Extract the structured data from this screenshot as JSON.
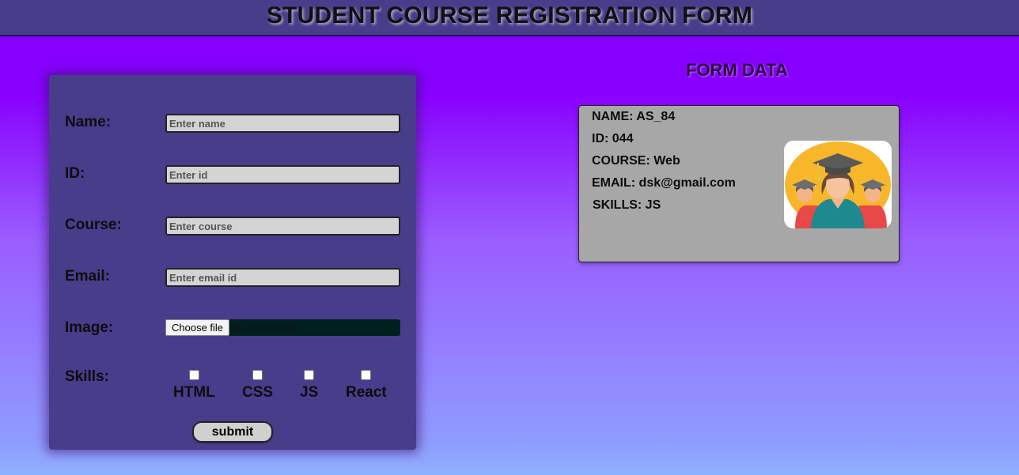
{
  "header": {
    "title": "STUDENT COURSE REGISTRATION FORM"
  },
  "form": {
    "name_label": "Name:",
    "name_placeholder": "Enter name",
    "id_label": "ID:",
    "id_placeholder": "Enter id",
    "course_label": "Course:",
    "course_placeholder": "Enter course",
    "email_label": "Email:",
    "email_placeholder": "Enter email id",
    "image_label": "Image:",
    "file_button": "Choose file",
    "file_status": "No file chosen",
    "skills_label": "Skills:",
    "skills": [
      {
        "label": "HTML",
        "checked": false
      },
      {
        "label": "CSS",
        "checked": false
      },
      {
        "label": "JS",
        "checked": false
      },
      {
        "label": "React",
        "checked": false
      }
    ],
    "submit_label": "submit"
  },
  "form_data": {
    "title": "FORM DATA",
    "name": "NAME: AS_84",
    "id": "ID: 044",
    "course": "COURSE: Web",
    "email": "EMAIL: dsk@gmail.com",
    "skills": "SKILLS: JS",
    "avatar_icon": "graduates-avatar-icon"
  },
  "colors": {
    "header_bg": "#483d8b",
    "form_card_bg": "#483d8b",
    "data_card_bg": "#a7a7a7",
    "page_gradient_top": "#8000ff",
    "page_gradient_bottom": "#8fb0ff",
    "avatar_circle": "#f8b62a"
  }
}
